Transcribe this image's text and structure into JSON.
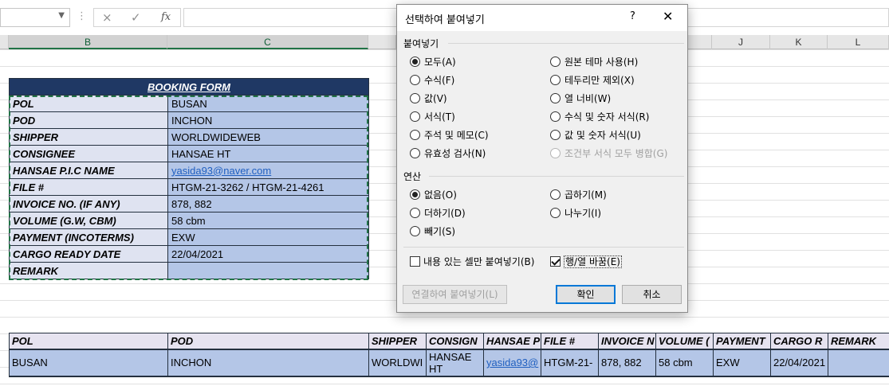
{
  "formula_bar": {
    "name_box_value": "",
    "cancel_icon": "×",
    "enter_icon": "✓",
    "fx_label": "fx",
    "formula_value": ""
  },
  "columns": [
    "B",
    "C",
    "J",
    "K",
    "L"
  ],
  "booking_form": {
    "title": "BOOKING FORM",
    "rows": [
      {
        "label": "POL",
        "value": "BUSAN"
      },
      {
        "label": "POD",
        "value": "INCHON"
      },
      {
        "label": "SHIPPER",
        "value": "WORLDWIDEWEB"
      },
      {
        "label": "CONSIGNEE",
        "value": "HANSAE HT"
      },
      {
        "label": "HANSAE P.I.C NAME",
        "value": "yasida93@naver.com"
      },
      {
        "label": "FILE #",
        "value": "HTGM-21-3262 / HTGM-21-4261"
      },
      {
        "label": "INVOICE NO. (IF ANY)",
        "value": "878, 882"
      },
      {
        "label": "VOLUME (G.W, CBM)",
        "value": "58 cbm"
      },
      {
        "label": "PAYMENT (INCOTERMS)",
        "value": "EXW"
      },
      {
        "label": "CARGO READY DATE",
        "value": "22/04/2021"
      },
      {
        "label": "REMARK",
        "value": ""
      }
    ]
  },
  "transposed": {
    "headers": [
      "POL",
      "POD",
      "SHIPPER",
      "CONSIGN",
      "HANSAE P",
      "FILE #",
      "INVOICE N",
      "VOLUME (",
      "PAYMENT",
      "CARGO R",
      "REMARK"
    ],
    "values": [
      "BUSAN",
      "INCHON",
      "WORLDWI",
      "HANSAE HT",
      "yasida93@",
      "HTGM-21-",
      "878, 882",
      "58 cbm",
      "EXW",
      "22/04/2021",
      ""
    ]
  },
  "dialog": {
    "title": "선택하여 붙여넣기",
    "help": "?",
    "close": "✕",
    "paste_group": "붙여넣기",
    "paste_left": [
      "모두(A)",
      "수식(F)",
      "값(V)",
      "서식(T)",
      "주석 및 메모(C)",
      "유효성 검사(N)"
    ],
    "paste_right": [
      "원본 테마 사용(H)",
      "테두리만 제외(X)",
      "열 너비(W)",
      "수식 및 숫자 서식(R)",
      "값 및 숫자 서식(U)",
      "조건부 서식 모두 병합(G)"
    ],
    "operation_group": "연산",
    "op_left": [
      "없음(O)",
      "더하기(D)",
      "빼기(S)"
    ],
    "op_right": [
      "곱하기(M)",
      "나누기(I)"
    ],
    "skip_blanks": "내용 있는 셀만 붙여넣기(B)",
    "transpose": "행/열 바꿈(E)",
    "paste_link": "연결하여 붙여넣기(L)",
    "ok": "확인",
    "cancel": "취소"
  }
}
